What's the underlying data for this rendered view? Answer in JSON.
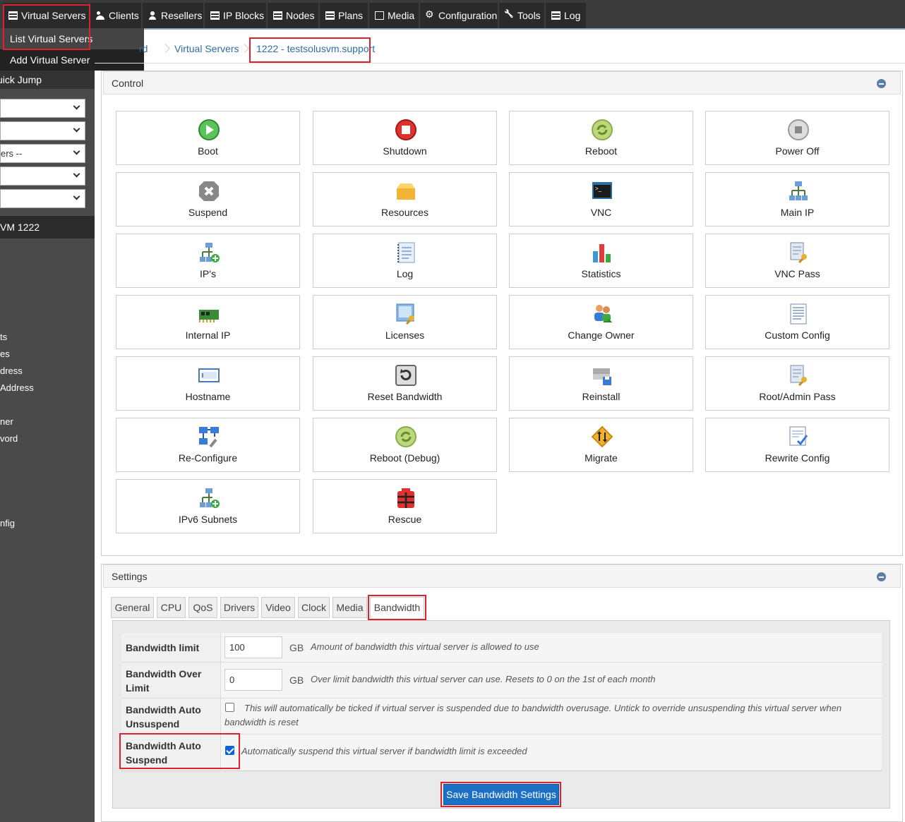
{
  "nav": {
    "items": [
      {
        "label": "Virtual Servers",
        "icon": "server-list-icon"
      },
      {
        "label": "Clients",
        "icon": "users-icon"
      },
      {
        "label": "Resellers",
        "icon": "user-icon"
      },
      {
        "label": "IP Blocks",
        "icon": "grid-icon"
      },
      {
        "label": "Nodes",
        "icon": "server-list-icon"
      },
      {
        "label": "Plans",
        "icon": "server-list-icon"
      },
      {
        "label": "Media",
        "icon": "document-icon"
      },
      {
        "label": "Configuration",
        "icon": "gear-icon"
      },
      {
        "label": "Tools",
        "icon": "wrench-icon"
      },
      {
        "label": "Log",
        "icon": "list-icon"
      }
    ],
    "dropdown": [
      "List Virtual Servers",
      "Add Virtual Server"
    ]
  },
  "sidebar": {
    "quick_jump": "uick Jump",
    "selects": [
      "",
      "",
      "ers --",
      "",
      ""
    ],
    "vm_title": "VM 1222",
    "links": [
      "ts",
      "es",
      "dress",
      "Address",
      "ner",
      "vord",
      "nfig"
    ]
  },
  "breadcrumb": [
    "rd",
    "Virtual Servers",
    "1222 - testsolusvm.support"
  ],
  "control": {
    "title": "Control",
    "buttons": [
      "Boot",
      "Shutdown",
      "Reboot",
      "Power Off",
      "Suspend",
      "Resources",
      "VNC",
      "Main IP",
      "IP's",
      "Log",
      "Statistics",
      "VNC Pass",
      "Internal IP",
      "Licenses",
      "Change Owner",
      "Custom Config",
      "Hostname",
      "Reset Bandwidth",
      "Reinstall",
      "Root/Admin Pass",
      "Re-Configure",
      "Reboot (Debug)",
      "Migrate",
      "Rewrite Config",
      "IPv6 Subnets",
      "Rescue"
    ]
  },
  "settings": {
    "title": "Settings",
    "tabs": [
      "General",
      "CPU",
      "QoS",
      "Drivers",
      "Video",
      "Clock",
      "Media",
      "Bandwidth"
    ],
    "active_tab": "Bandwidth",
    "bandwidth": {
      "limit_label": "Bandwidth limit",
      "limit_value": "100",
      "limit_unit": "GB",
      "limit_desc": "Amount of bandwidth this virtual server is allowed to use",
      "over_label": "Bandwidth Over Limit",
      "over_value": "0",
      "over_unit": "GB",
      "over_desc": "Over limit bandwidth this virtual server can use. Resets to 0 on the 1st of each month",
      "unsuspend_label": "Bandwidth Auto Unsuspend",
      "unsuspend_checked": false,
      "unsuspend_desc": "This will automatically be ticked if virtual server is suspended due to bandwidth overusage. Untick to override unsuspending this virtual server when bandwidth is reset",
      "suspend_label": "Bandwidth Auto Suspend",
      "suspend_checked": true,
      "suspend_desc": "Automatically suspend this virtual server if bandwidth limit is exceeded",
      "save_label": "Save Bandwidth Settings"
    }
  },
  "colors": {
    "highlight": "#d9232d",
    "link": "#2e6da4",
    "primary": "#1b6fc4",
    "nav_bg": "#3b3b3b"
  }
}
